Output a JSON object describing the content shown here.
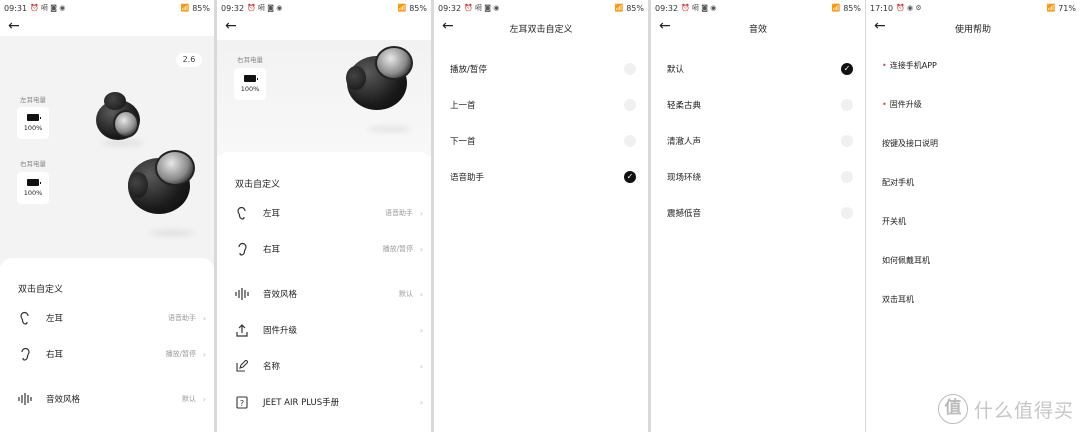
{
  "panel1": {
    "status": {
      "time": "09:31",
      "left_glyphs": "⏰ 嗬 ◙ ◉",
      "battery": "85%"
    },
    "version": "2.6",
    "left_battery": {
      "label": "左耳电量",
      "percent": "100%"
    },
    "right_battery": {
      "label": "右耳电量",
      "percent": "100%"
    },
    "section_title": "双击自定义",
    "items": [
      {
        "label": "左耳",
        "value": "语音助手"
      },
      {
        "label": "右耳",
        "value": "播放/暂停"
      },
      {
        "label": "音效风格",
        "value": "默认"
      }
    ]
  },
  "panel2": {
    "status": {
      "time": "09:32",
      "left_glyphs": "⏰ 嗬 ◙ ◉",
      "battery": "85%"
    },
    "right_battery": {
      "label": "右耳电量",
      "percent": "100%"
    },
    "section_title": "双击自定义",
    "items": [
      {
        "label": "左耳",
        "value": "语音助手"
      },
      {
        "label": "右耳",
        "value": "播放/暂停"
      },
      {
        "label": "音效风格",
        "value": "默认"
      },
      {
        "label": "固件升级",
        "value": ""
      },
      {
        "label": "名称",
        "value": ""
      },
      {
        "label": "JEET AIR PLUS手册",
        "value": ""
      }
    ]
  },
  "panel3": {
    "status": {
      "time": "09:32",
      "left_glyphs": "⏰ 嗬 ◙ ◉",
      "battery": "85%"
    },
    "title": "左耳双击自定义",
    "options": [
      {
        "label": "播放/暂停",
        "selected": false
      },
      {
        "label": "上一首",
        "selected": false
      },
      {
        "label": "下一首",
        "selected": false
      },
      {
        "label": "语音助手",
        "selected": true
      }
    ]
  },
  "panel4": {
    "status": {
      "time": "09:32",
      "left_glyphs": "⏰ 嗬 ◙ ◉",
      "battery": "85%"
    },
    "title": "音效",
    "options": [
      {
        "label": "默认",
        "selected": true
      },
      {
        "label": "轻柔古典",
        "selected": false
      },
      {
        "label": "清澈人声",
        "selected": false
      },
      {
        "label": "现场环绕",
        "selected": false
      },
      {
        "label": "震撼低音",
        "selected": false
      }
    ]
  },
  "panel5": {
    "status": {
      "time": "17:10",
      "left_glyphs": "⏰ ◉ ⚙",
      "battery": "71%"
    },
    "title": "使用帮助",
    "items": [
      {
        "label": "连接手机APP",
        "highlight": true
      },
      {
        "label": "固件升级",
        "highlight": true
      },
      {
        "label": "按键及接口说明",
        "highlight": false
      },
      {
        "label": "配对手机",
        "highlight": false
      },
      {
        "label": "开关机",
        "highlight": false
      },
      {
        "label": "如何佩戴耳机",
        "highlight": false
      },
      {
        "label": "双击耳机",
        "highlight": false
      }
    ]
  },
  "common": {
    "check_glyph": "✓",
    "chevron": "›",
    "back_glyph": "←",
    "dot_glyph": "•"
  },
  "watermark": {
    "logo": "值",
    "text": "什么值得买"
  },
  "colors": {
    "accent_red": "#e2463a",
    "selected": "#111111"
  }
}
